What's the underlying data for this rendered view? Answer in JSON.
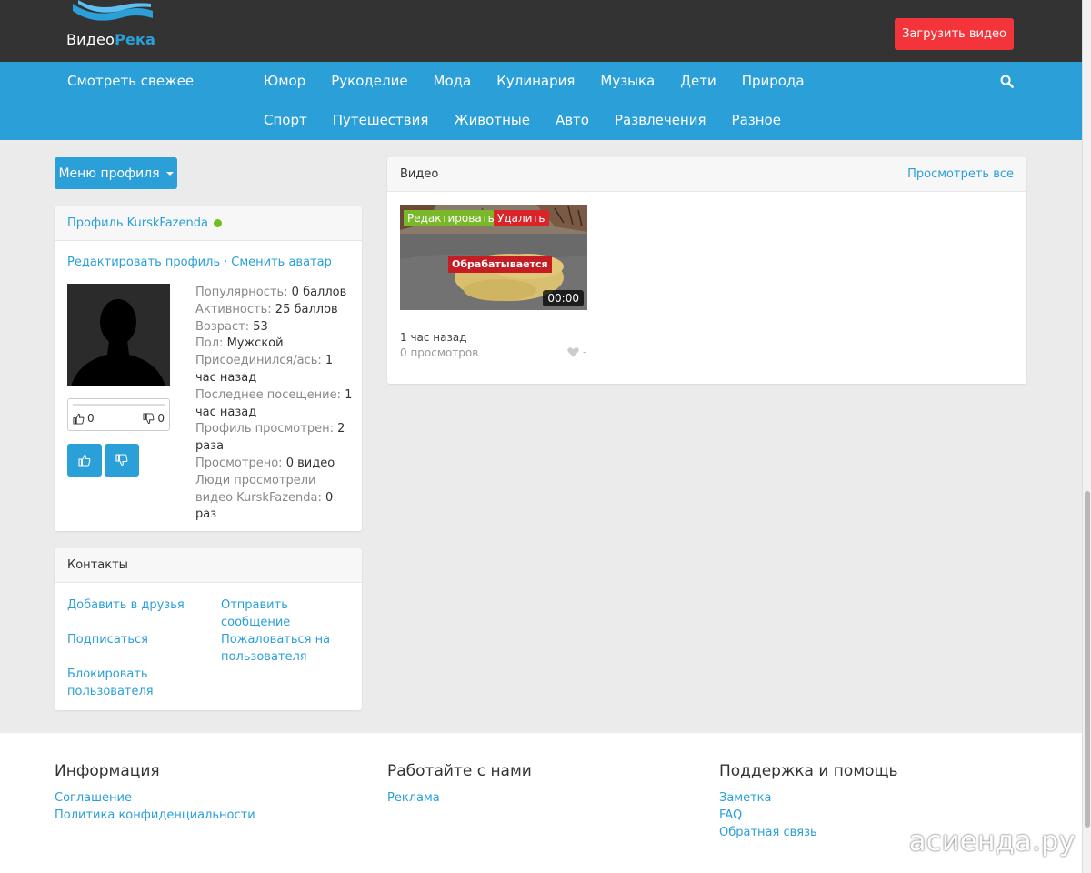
{
  "header": {
    "logo_text": "Видео",
    "logo_accent": "Река",
    "upload_label": "Загрузить видео"
  },
  "nav": {
    "fresh": "Смотреть свежее",
    "row1": [
      "Юмор",
      "Рукоделие",
      "Мода",
      "Кулинария",
      "Музыка",
      "Дети",
      "Природа"
    ],
    "row2": [
      "Спорт",
      "Путешествия",
      "Животные",
      "Авто",
      "Развлечения",
      "Разное"
    ]
  },
  "profile_menu": {
    "label": "Меню профиля"
  },
  "profile": {
    "title": "Профиль KurskFazenda",
    "edit_link": "Редактировать профиль",
    "separator": "·",
    "avatar_link": "Сменить аватар",
    "likes": "0",
    "dislikes": "0",
    "stats": [
      {
        "label": "Популярность:",
        "value": "0 баллов"
      },
      {
        "label": "Активность:",
        "value": "25 баллов"
      },
      {
        "label": "Возраст:",
        "value": "53"
      },
      {
        "label": "Пол:",
        "value": "Мужской"
      },
      {
        "label": "Присоединился/ась:",
        "value": "1 час назад"
      },
      {
        "label": "Последнее посещение:",
        "value": "1 час назад"
      },
      {
        "label": "Профиль просмотрен:",
        "value": "2 раза"
      },
      {
        "label": "Просмотрено:",
        "value": "0 видео"
      },
      {
        "label": "Люди просмотрели видео KurskFazenda:",
        "value": "0 раз"
      }
    ]
  },
  "contacts": {
    "title": "Контакты",
    "add_friend": "Добавить в друзья",
    "send_message": "Отправить сообщение",
    "subscribe": "Подписаться",
    "report": "Пожаловаться на пользователя",
    "block": "Блокировать пользователя"
  },
  "videos": {
    "title": "Видео",
    "view_all": "Просмотреть все",
    "item": {
      "edit": "Редактировать",
      "delete": "Удалить",
      "processing": "Обрабатывается",
      "duration": "00:00",
      "time": "1 час назад",
      "views": "0 просмотров",
      "likes": "-"
    }
  },
  "footer": {
    "info": {
      "title": "Информация",
      "links": [
        "Соглашение",
        "Политика конфиденциальности"
      ]
    },
    "work": {
      "title": "Работайте с нами",
      "links": [
        "Реклама"
      ]
    },
    "support": {
      "title": "Поддержка и помощь",
      "links": [
        "Заметка",
        "FAQ",
        "Обратная связь"
      ]
    },
    "watermark": "асиенда.ру"
  },
  "colors": {
    "accent": "#2a9fd8",
    "topbar": "#333333",
    "upload": "#f4343b",
    "online": "#6fbf1f"
  }
}
